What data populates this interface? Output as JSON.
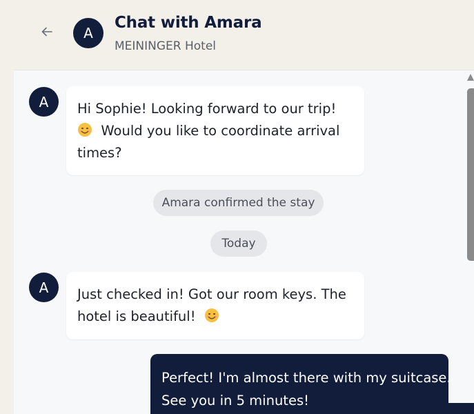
{
  "header": {
    "back_icon": "arrow-left-icon",
    "avatar_initial": "A",
    "title": "Chat with Amara",
    "subtitle": "MEININGER Hotel"
  },
  "messages": [
    {
      "sender": "Amara",
      "avatar_initial": "A",
      "lines": [
        "Hi Sophie! Looking forward to our trip!",
        "Would you like to coordinate arrival",
        "times?"
      ],
      "emoji": "smiling-face-icon"
    },
    {
      "system_text": "Amara confirmed the stay"
    },
    {
      "date_separator": "Today"
    },
    {
      "sender": "Amara",
      "avatar_initial": "A",
      "lines": [
        "Just checked in! Got our room keys. The",
        "hotel is beautiful!"
      ],
      "emoji": "smiling-face-icon"
    },
    {
      "sender": "Sophie",
      "lines": [
        "Perfect! I'm almost there with my suitcase.",
        "See you in 5 minutes!"
      ]
    }
  ],
  "colors": {
    "brand": "#121d3b",
    "page_bg": "#f3f0ea",
    "chat_bg": "#f7f8fa",
    "incoming_bubble": "#ffffff",
    "system_pill": "#e5e6e9",
    "scrollbar": "#8a8a8a"
  }
}
